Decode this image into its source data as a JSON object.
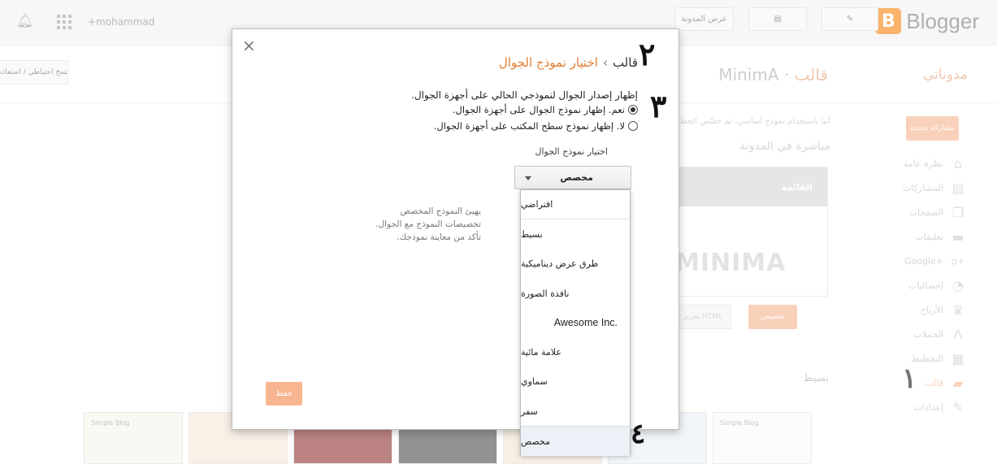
{
  "topbar": {
    "logo_text": "Blogger",
    "logo_letter": "B",
    "view_blog_label": "عرض المدونة",
    "user": "+mohammad",
    "icons": [
      "edit-icon",
      "posts-icon",
      "apps-grid-icon",
      "bell-icon"
    ]
  },
  "page": {
    "blog_name": "مدوناتي",
    "title_section": "قالب",
    "title_sep": "·",
    "title_theme": "MinimA",
    "backup_button": "نسخ احتياطي / استعادة",
    "new_post_button": "مشاركة جديدة",
    "info_line": "أنبا باستخدام نموذج أساسي، ثم خصّص الخط",
    "live_heading": "مباشرة في المدونة",
    "preview_menu": "القائمة",
    "preview_title": "MINIMA",
    "customize_button": "تخصيص",
    "edit_html_button": "تحرير HTML",
    "simple_heading": "بسيط",
    "thumbs": [
      "Simple Blog",
      "",
      "",
      "",
      "",
      "",
      "Simple Blog"
    ]
  },
  "sidebar": {
    "items": [
      {
        "label": "نظرة عامة",
        "icon": "home-icon"
      },
      {
        "label": "المشاركات",
        "icon": "posts-icon"
      },
      {
        "label": "الصفحات",
        "icon": "pages-icon"
      },
      {
        "label": "تعليقات",
        "icon": "comments-icon"
      },
      {
        "label": "Google+",
        "icon": "google-plus-icon"
      },
      {
        "label": "إحصائيات",
        "icon": "stats-icon"
      },
      {
        "label": "الأرباح",
        "icon": "trophy-icon"
      },
      {
        "label": "الحملات",
        "icon": "campaigns-icon"
      },
      {
        "label": "التخطيط",
        "icon": "layout-icon"
      },
      {
        "label": "قالب",
        "icon": "template-icon"
      },
      {
        "label": "إعدادات",
        "icon": "settings-icon"
      }
    ],
    "active_index": 9
  },
  "annotations": {
    "n1": "١",
    "n2": "٢",
    "n3": "٣",
    "n4": "٤"
  },
  "dialog": {
    "close": "×",
    "crumb_parent": "قالب",
    "crumb_sep": "›",
    "crumb_current": "اختيار نموذج الجوال",
    "question": "إظهار إصدار الجوال لنموذجي الحالي على أجهزة الجوال.",
    "option_yes": "نعم. إظهار نموذج الجوال على أجهزة الجوال.",
    "option_no": "لا. إظهار نموذج سطح المكتب على أجهزة الجوال.",
    "selected_option": "yes",
    "select_label": "اختيار نموذج الجوال",
    "select_value": "مخصص",
    "help_lines": [
      "يهيئ النموذج المخصص",
      "تخصيصات النموذج مع الجوال.",
      "تأكد من معاينة نموذجك."
    ],
    "save_button": "حفظ"
  },
  "dropdown": {
    "options": [
      "افتراضي",
      "بسيط",
      "طرق عرض ديناميكية",
      "نافذة الصورة",
      "Awesome Inc.",
      "علامة مائية",
      "سماوي",
      "سفر",
      "مخصص"
    ],
    "selected_index": 8
  }
}
